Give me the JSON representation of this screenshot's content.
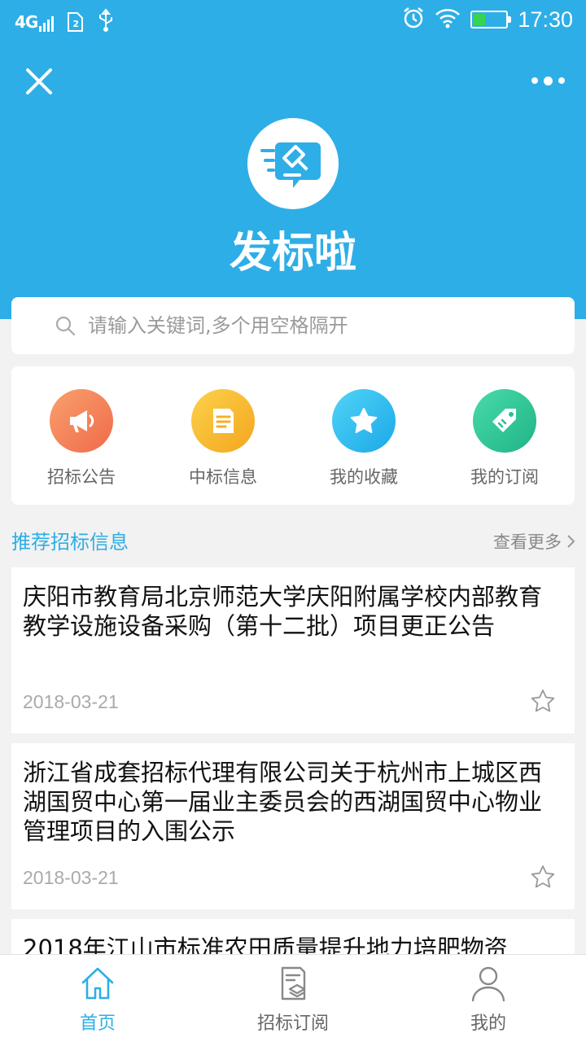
{
  "status_bar": {
    "network": "4G",
    "sim_badge": "2",
    "time": "17:30"
  },
  "colors": {
    "primary": "#2eaee6",
    "announce": "#f48057",
    "winning": "#f7b626",
    "favorite": "#27b9ee",
    "subscribe": "#2ec89a"
  },
  "header": {
    "app_name": "发标啦"
  },
  "search": {
    "placeholder": "请输入关键词,多个用空格隔开"
  },
  "quick_actions": [
    {
      "label": "招标公告",
      "icon": "megaphone-icon"
    },
    {
      "label": "中标信息",
      "icon": "document-icon"
    },
    {
      "label": "我的收藏",
      "icon": "star-icon"
    },
    {
      "label": "我的订阅",
      "icon": "tag-icon"
    }
  ],
  "section": {
    "title": "推荐招标信息",
    "more": "查看更多"
  },
  "listings": [
    {
      "title": "庆阳市教育局北京师范大学庆阳附属学校内部教育教学设施设备采购（第十二批）项目更正公告",
      "date": "2018-03-21"
    },
    {
      "title": "浙江省成套招标代理有限公司关于杭州市上城区西湖国贸中心第一届业主委员会的西湖国贸中心物业管理项目的入围公示",
      "date": "2018-03-21"
    },
    {
      "title": "2018年江山市标准农田质量提升地力培肥物资",
      "date": ""
    }
  ],
  "tabbar": [
    {
      "label": "首页",
      "icon": "home-icon",
      "active": true
    },
    {
      "label": "招标订阅",
      "icon": "subscription-icon",
      "active": false
    },
    {
      "label": "我的",
      "icon": "user-icon",
      "active": false
    }
  ]
}
